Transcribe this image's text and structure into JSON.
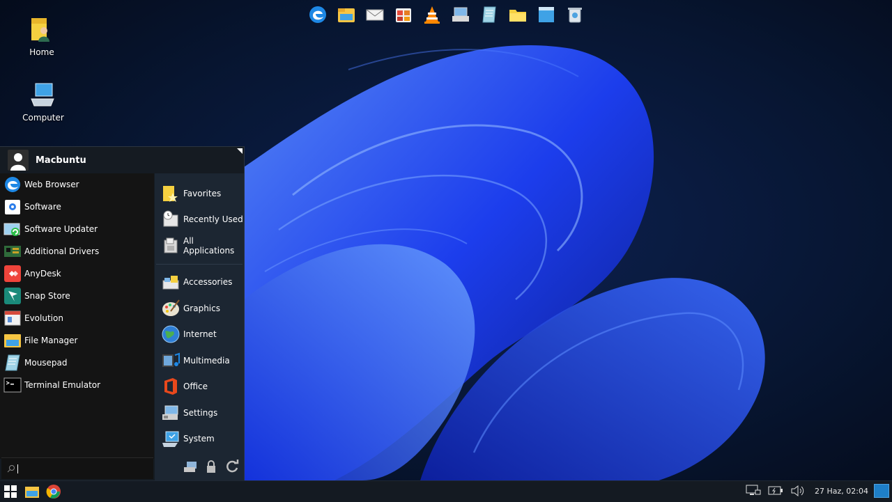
{
  "desktop": {
    "icons": [
      {
        "label": "Home",
        "icon": "home-folder-icon"
      },
      {
        "label": "Computer",
        "icon": "computer-icon"
      }
    ]
  },
  "dock": {
    "icons": [
      "edge-browser-icon",
      "file-manager-icon",
      "mail-icon",
      "software-center-icon",
      "vlc-icon",
      "network-icon",
      "mousepad-icon",
      "folder-icon",
      "window-icon",
      "trash-icon"
    ]
  },
  "menu": {
    "username": "Macbuntu",
    "apps": [
      {
        "label": "Web Browser",
        "icon": "edge-icon"
      },
      {
        "label": "Software",
        "icon": "software-icon"
      },
      {
        "label": "Software Updater",
        "icon": "updater-icon"
      },
      {
        "label": "Additional Drivers",
        "icon": "drivers-icon"
      },
      {
        "label": "AnyDesk",
        "icon": "anydesk-icon"
      },
      {
        "label": "Snap Store",
        "icon": "snap-store-icon"
      },
      {
        "label": "Evolution",
        "icon": "evolution-icon"
      },
      {
        "label": "File Manager",
        "icon": "file-manager-icon"
      },
      {
        "label": "Mousepad",
        "icon": "mousepad-icon"
      },
      {
        "label": "Terminal Emulator",
        "icon": "terminal-icon"
      }
    ],
    "categories_top": [
      {
        "label": "Favorites",
        "icon": "favorites-icon"
      },
      {
        "label": "Recently Used",
        "icon": "recent-icon"
      },
      {
        "label": "All Applications",
        "icon": "all-apps-icon"
      }
    ],
    "categories": [
      {
        "label": "Accessories",
        "icon": "accessories-icon"
      },
      {
        "label": "Graphics",
        "icon": "graphics-icon"
      },
      {
        "label": "Internet",
        "icon": "internet-icon"
      },
      {
        "label": "Multimedia",
        "icon": "multimedia-icon"
      },
      {
        "label": "Office",
        "icon": "office-icon"
      },
      {
        "label": "Settings",
        "icon": "settings-icon"
      },
      {
        "label": "System",
        "icon": "system-icon"
      }
    ],
    "search": {
      "value": "",
      "placeholder": ""
    },
    "actions": [
      "settings-manager-icon",
      "lock-icon",
      "logout-icon"
    ]
  },
  "taskbar": {
    "left_icons": [
      "start-menu-icon",
      "file-manager-icon",
      "chrome-icon"
    ],
    "tray_icons": [
      "network-icon",
      "battery-icon",
      "volume-icon"
    ],
    "clock": "27 Haz, 02:04"
  },
  "colors": {
    "accent": "#1e7fc8",
    "wallpaper": "#1a3cff"
  }
}
